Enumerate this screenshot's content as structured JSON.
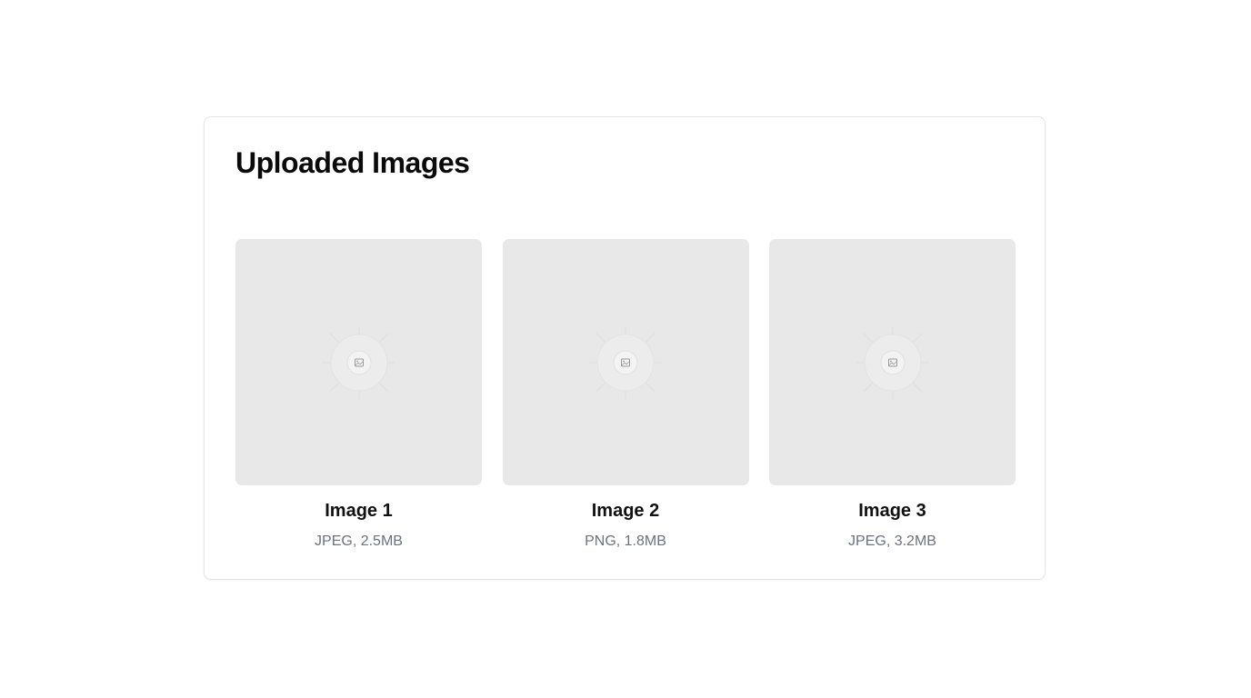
{
  "page": {
    "title": "Uploaded Images"
  },
  "images": [
    {
      "name": "Image 1",
      "meta": "JPEG, 2.5MB",
      "icon": "image-placeholder-icon"
    },
    {
      "name": "Image 2",
      "meta": "PNG, 1.8MB",
      "icon": "image-placeholder-icon"
    },
    {
      "name": "Image 3",
      "meta": "JPEG, 3.2MB",
      "icon": "image-placeholder-icon"
    }
  ],
  "colors": {
    "thumb_bg": "#e8e8e8",
    "title": "#0a0a0a",
    "meta": "#6b7280",
    "border": "#e4e4e7"
  }
}
